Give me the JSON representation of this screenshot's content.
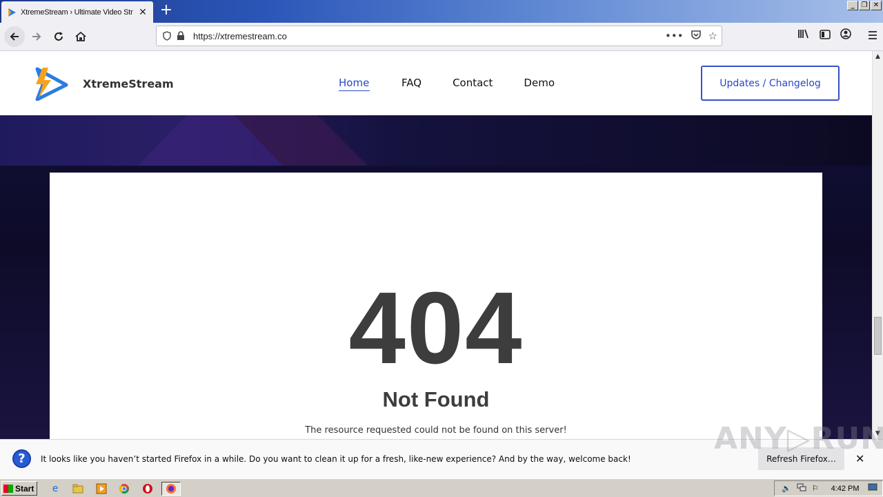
{
  "browser": {
    "tab_title": "XtremeStream › Ultimate Video Str",
    "url": "https://xtremestream.co"
  },
  "site": {
    "logo_text": "XtremeStream",
    "nav": [
      "Home",
      "FAQ",
      "Contact",
      "Demo"
    ],
    "cta_label": "Updates / Changelog"
  },
  "error": {
    "code": "404",
    "title": "Not Found",
    "message": "The resource requested could not be found on this server!"
  },
  "notification": {
    "text": "It looks like you haven’t started Firefox in a while. Do you want to clean it up for a fresh, like-new experience? And by the way, welcome back!",
    "button": "Refresh Firefox…"
  },
  "watermark": "ANY▷RUN",
  "taskbar": {
    "start": "Start",
    "clock": "4:42 PM"
  }
}
